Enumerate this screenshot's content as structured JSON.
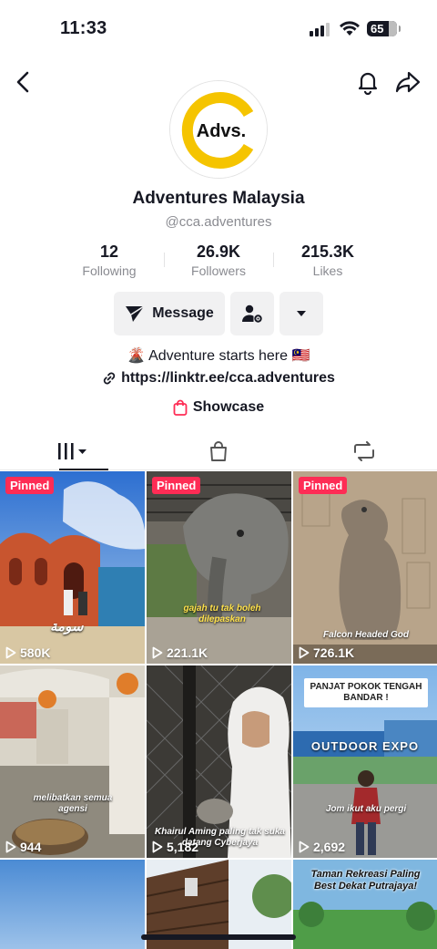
{
  "status_bar": {
    "time": "11:33",
    "battery": "65"
  },
  "profile": {
    "avatar_text": "Advs.",
    "name": "Adventures Malaysia",
    "handle": "@cca.adventures",
    "stats": [
      {
        "value": "12",
        "label": "Following"
      },
      {
        "value": "26.9K",
        "label": "Followers"
      },
      {
        "value": "215.3K",
        "label": "Likes"
      }
    ],
    "message_label": "Message",
    "bio": "🌋 Adventure starts here 🇲🇾",
    "link": "https://linktr.ee/cca.adventures",
    "showcase_label": "Showcase"
  },
  "tabs": [
    "videos",
    "shop",
    "reposts"
  ],
  "videos": [
    {
      "pinned": "Pinned",
      "views": "580K",
      "caption": "سومة"
    },
    {
      "pinned": "Pinned",
      "views": "221.1K",
      "caption": "gajah tu tak boleh dilepaskan"
    },
    {
      "pinned": "Pinned",
      "views": "726.1K",
      "caption": "Falcon Headed God"
    },
    {
      "pinned": "",
      "views": "944",
      "caption": "melibatkan semua agensi"
    },
    {
      "pinned": "",
      "views": "5,182",
      "caption": "Khairul Aming paling tak suka datang Cyberjaya"
    },
    {
      "pinned": "",
      "views": "2,692",
      "caption": "Jom ikut aku pergi",
      "banner": "PANJAT POKOK TENGAH BANDAR !",
      "sign": "OUTDOOR EXPO"
    },
    {
      "pinned": "",
      "views": "",
      "caption": ""
    },
    {
      "pinned": "",
      "views": "",
      "caption": ""
    },
    {
      "pinned": "",
      "views": "",
      "caption": "Taman Rekreasi Paling Best Dekat Putrajaya!"
    }
  ],
  "colors": {
    "accent": "#fe2c55",
    "logo": "#f5c400"
  }
}
